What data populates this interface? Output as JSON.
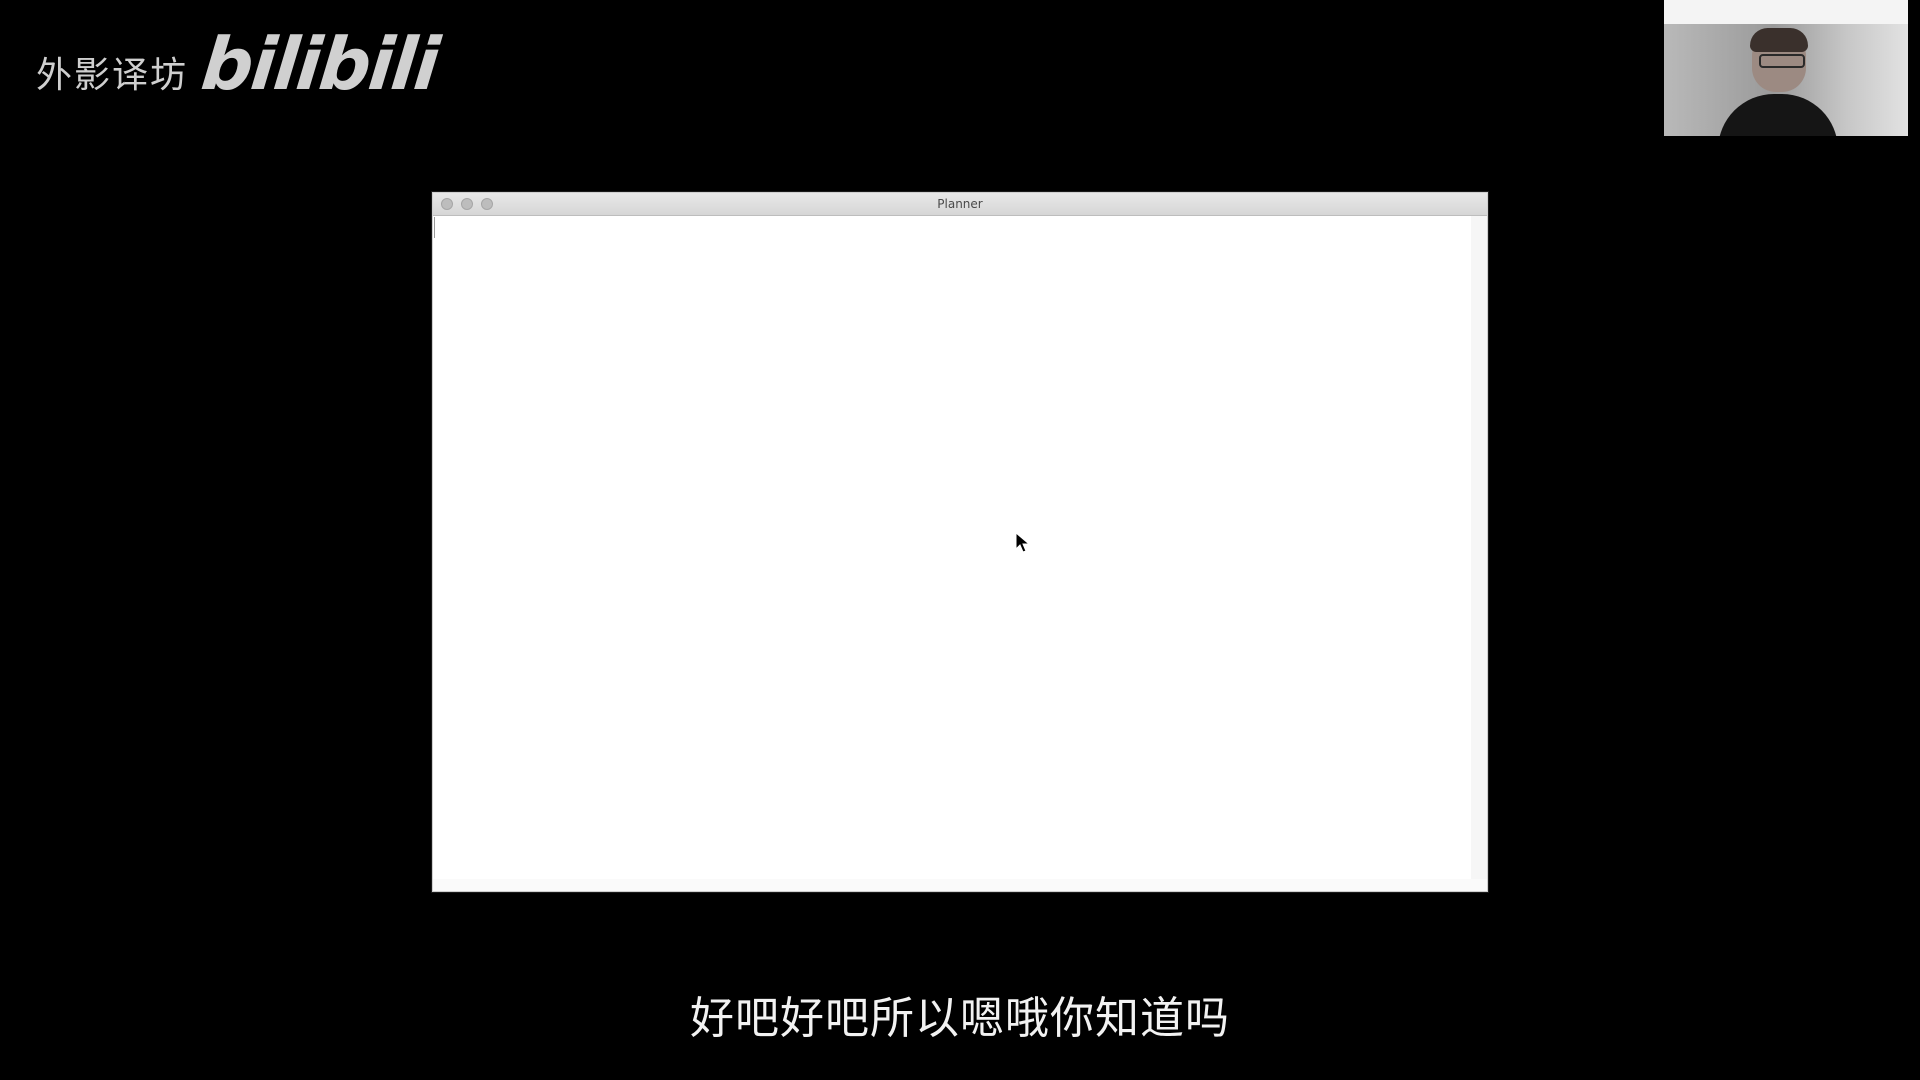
{
  "watermark": {
    "cn_text": "外影译坊",
    "logo_text": "bilibili"
  },
  "window": {
    "title": "Planner"
  },
  "subtitle": {
    "text": "好吧好吧所以嗯哦你知道吗"
  },
  "icons": {
    "cursor": "arrow-cursor-icon",
    "window_controls": [
      "close-button-icon",
      "minimize-button-icon",
      "zoom-button-icon"
    ]
  }
}
